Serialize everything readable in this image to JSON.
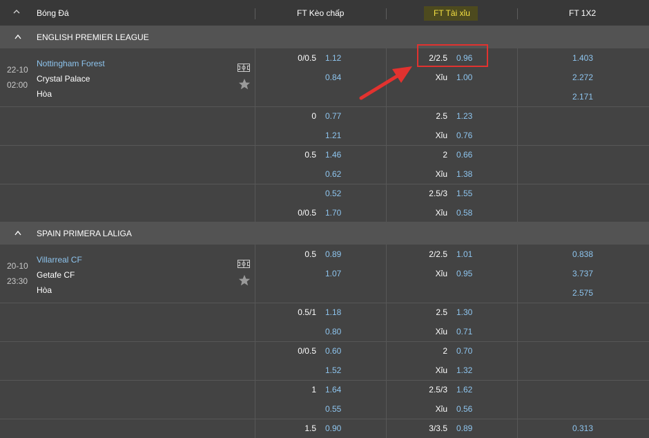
{
  "header": {
    "sport": "Bóng Đá",
    "handicap": "FT Kèo chấp",
    "overunder": "FT Tài xỉu",
    "onextwo": "FT 1X2"
  },
  "leagues": [
    {
      "name": "ENGLISH PREMIER LEAGUE",
      "match": {
        "date": "22-10",
        "time": "02:00",
        "home": "Nottingham Forest",
        "away": "Crystal Palace",
        "draw": "Hòa",
        "rows": [
          {
            "hdp_line": "0/0.5",
            "hdp": "1.12",
            "ou_line": "2/2.5",
            "ou": "0.96",
            "x12": "1.403"
          },
          {
            "hdp_line": "",
            "hdp": "0.84",
            "ou_line": "Xỉu",
            "ou": "1.00",
            "x12": "2.272"
          },
          {
            "hdp_line": "",
            "hdp": "",
            "ou_line": "",
            "ou": "",
            "x12": "2.171"
          },
          {
            "hdp_line": "0",
            "hdp": "0.77",
            "ou_line": "2.5",
            "ou": "1.23",
            "x12": ""
          },
          {
            "hdp_line": "",
            "hdp": "1.21",
            "ou_line": "Xỉu",
            "ou": "0.76",
            "x12": ""
          },
          {
            "hdp_line": "0.5",
            "hdp": "1.46",
            "ou_line": "2",
            "ou": "0.66",
            "x12": ""
          },
          {
            "hdp_line": "",
            "hdp": "0.62",
            "ou_line": "Xỉu",
            "ou": "1.38",
            "x12": ""
          },
          {
            "hdp_line": "",
            "hdp": "0.52",
            "ou_line": "2.5/3",
            "ou": "1.55",
            "x12": ""
          },
          {
            "hdp_line": "0/0.5",
            "hdp": "1.70",
            "ou_line": "Xỉu",
            "ou": "0.58",
            "x12": ""
          }
        ]
      }
    },
    {
      "name": "SPAIN PRIMERA LALIGA",
      "match": {
        "date": "20-10",
        "time": "23:30",
        "home": "Villarreal CF",
        "away": "Getafe CF",
        "draw": "Hòa",
        "rows": [
          {
            "hdp_line": "0.5",
            "hdp": "0.89",
            "ou_line": "2/2.5",
            "ou": "1.01",
            "x12": "0.838"
          },
          {
            "hdp_line": "",
            "hdp": "1.07",
            "ou_line": "Xỉu",
            "ou": "0.95",
            "x12": "3.737"
          },
          {
            "hdp_line": "",
            "hdp": "",
            "ou_line": "",
            "ou": "",
            "x12": "2.575"
          },
          {
            "hdp_line": "0.5/1",
            "hdp": "1.18",
            "ou_line": "2.5",
            "ou": "1.30",
            "x12": ""
          },
          {
            "hdp_line": "",
            "hdp": "0.80",
            "ou_line": "Xỉu",
            "ou": "0.71",
            "x12": ""
          },
          {
            "hdp_line": "0/0.5",
            "hdp": "0.60",
            "ou_line": "2",
            "ou": "0.70",
            "x12": ""
          },
          {
            "hdp_line": "",
            "hdp": "1.52",
            "ou_line": "Xỉu",
            "ou": "1.32",
            "x12": ""
          },
          {
            "hdp_line": "1",
            "hdp": "1.64",
            "ou_line": "2.5/3",
            "ou": "1.62",
            "x12": ""
          },
          {
            "hdp_line": "",
            "hdp": "0.55",
            "ou_line": "Xỉu",
            "ou": "0.56",
            "x12": ""
          },
          {
            "hdp_line": "1.5",
            "hdp": "0.90",
            "ou_line": "3/3.5",
            "ou": "0.89",
            "x12": "0.313"
          }
        ]
      }
    }
  ],
  "icons": {
    "collapse": "chevron-up-icon",
    "field": "pitch-icon",
    "favorite": "star-icon"
  },
  "colors": {
    "odds": "#8ec5ef",
    "highlight_header": "#f5e142",
    "callout": "#e2322f"
  }
}
